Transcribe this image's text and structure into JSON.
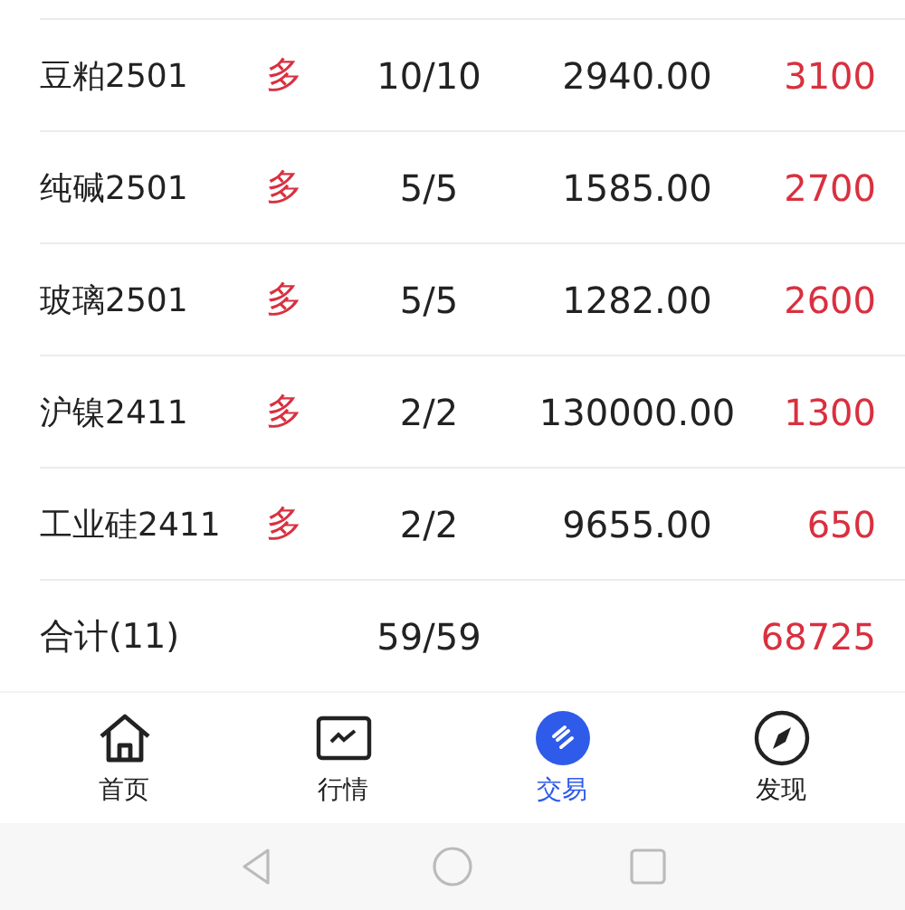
{
  "positions": [
    {
      "name": "豆粕2501",
      "side": "多",
      "quantity": "10/10",
      "price": "2940.00",
      "profit": "3100"
    },
    {
      "name": "纯碱2501",
      "side": "多",
      "quantity": "5/5",
      "price": "1585.00",
      "profit": "2700"
    },
    {
      "name": "玻璃2501",
      "side": "多",
      "quantity": "5/5",
      "price": "1282.00",
      "profit": "2600"
    },
    {
      "name": "沪镍2411",
      "side": "多",
      "quantity": "2/2",
      "price": "130000.00",
      "profit": "1300"
    },
    {
      "name": "工业硅2411",
      "side": "多",
      "quantity": "2/2",
      "price": "9655.00",
      "profit": "650"
    }
  ],
  "total": {
    "label": "合计(11)",
    "quantity": "59/59",
    "profit": "68725"
  },
  "nav": [
    {
      "kind": "home",
      "label": "首页",
      "selected": false
    },
    {
      "kind": "chart",
      "label": "行情",
      "selected": false
    },
    {
      "kind": "trade",
      "label": "交易",
      "selected": true
    },
    {
      "kind": "discover",
      "label": "发现",
      "selected": false
    }
  ]
}
